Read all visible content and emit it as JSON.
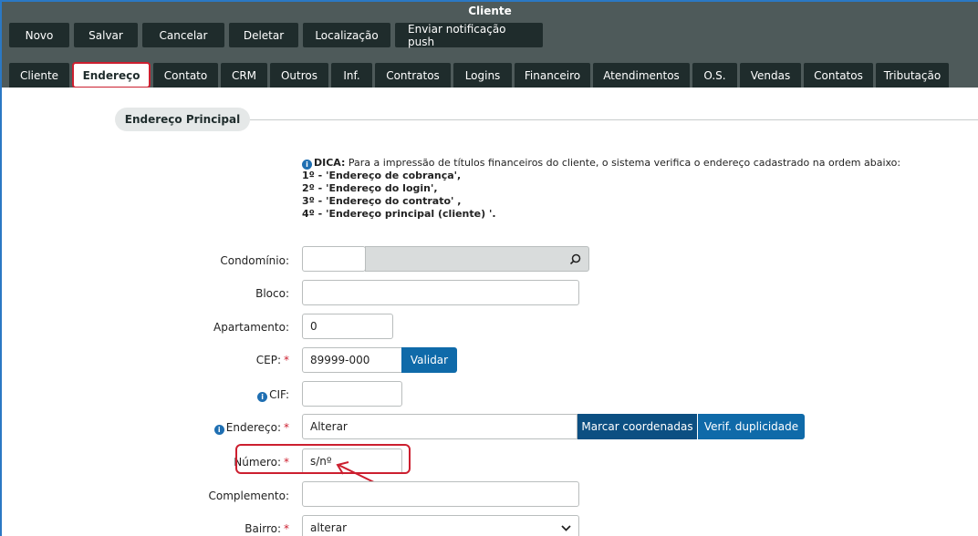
{
  "window": {
    "title": "Cliente"
  },
  "toolbar": [
    {
      "label": "Novo"
    },
    {
      "label": "Salvar"
    },
    {
      "label": "Cancelar"
    },
    {
      "label": "Deletar"
    },
    {
      "label": "Localização"
    },
    {
      "label": "Enviar notificação push"
    }
  ],
  "tabs": [
    {
      "label": "Cliente"
    },
    {
      "label": "Endereço",
      "active": true
    },
    {
      "label": "Contato"
    },
    {
      "label": "CRM"
    },
    {
      "label": "Outros"
    },
    {
      "label": "Inf."
    },
    {
      "label": "Contratos"
    },
    {
      "label": "Logins"
    },
    {
      "label": "Financeiro"
    },
    {
      "label": "Atendimentos"
    },
    {
      "label": "O.S."
    },
    {
      "label": "Vendas"
    },
    {
      "label": "Contatos"
    },
    {
      "label": "Tributação"
    }
  ],
  "section": {
    "title": "Endereço Principal"
  },
  "dica": {
    "prefix": "DICA:",
    "text": " Para a impressão de títulos financeiros do cliente, o sistema verifica o endereço cadastrado na ordem abaixo:",
    "lines": [
      "1º - 'Endereço de cobrança',",
      "2º - 'Endereço do login',",
      "3º - 'Endereço do contrato' ,",
      "4º - 'Endereço principal (cliente) '."
    ]
  },
  "form": {
    "condominio": {
      "label": "Condomínio:",
      "value": ""
    },
    "bloco": {
      "label": "Bloco:",
      "value": ""
    },
    "apartamento": {
      "label": "Apartamento:",
      "value": "0"
    },
    "cep": {
      "label": "CEP:",
      "value": "89999-000",
      "button": "Validar"
    },
    "cif": {
      "label": "CIF:",
      "value": ""
    },
    "endereco": {
      "label": "Endereço:",
      "value": "Alterar",
      "btn_coords": "Marcar coordenadas",
      "btn_dup": "Verif. duplicidade"
    },
    "numero": {
      "label": "Número:",
      "value": "s/nº"
    },
    "complemento": {
      "label": "Complemento:",
      "value": ""
    },
    "bairro": {
      "label": "Bairro:",
      "value": "alterar"
    }
  },
  "colors": {
    "header": "#4e5a5a",
    "button_dark": "#1f2c2c",
    "accent_blue": "#0f6aa9",
    "required": "#cc1f2f",
    "highlight": "#cc1f2f"
  },
  "icons": {
    "search": "search-icon",
    "info": "info-icon",
    "chevron": "chevron-down-icon"
  }
}
